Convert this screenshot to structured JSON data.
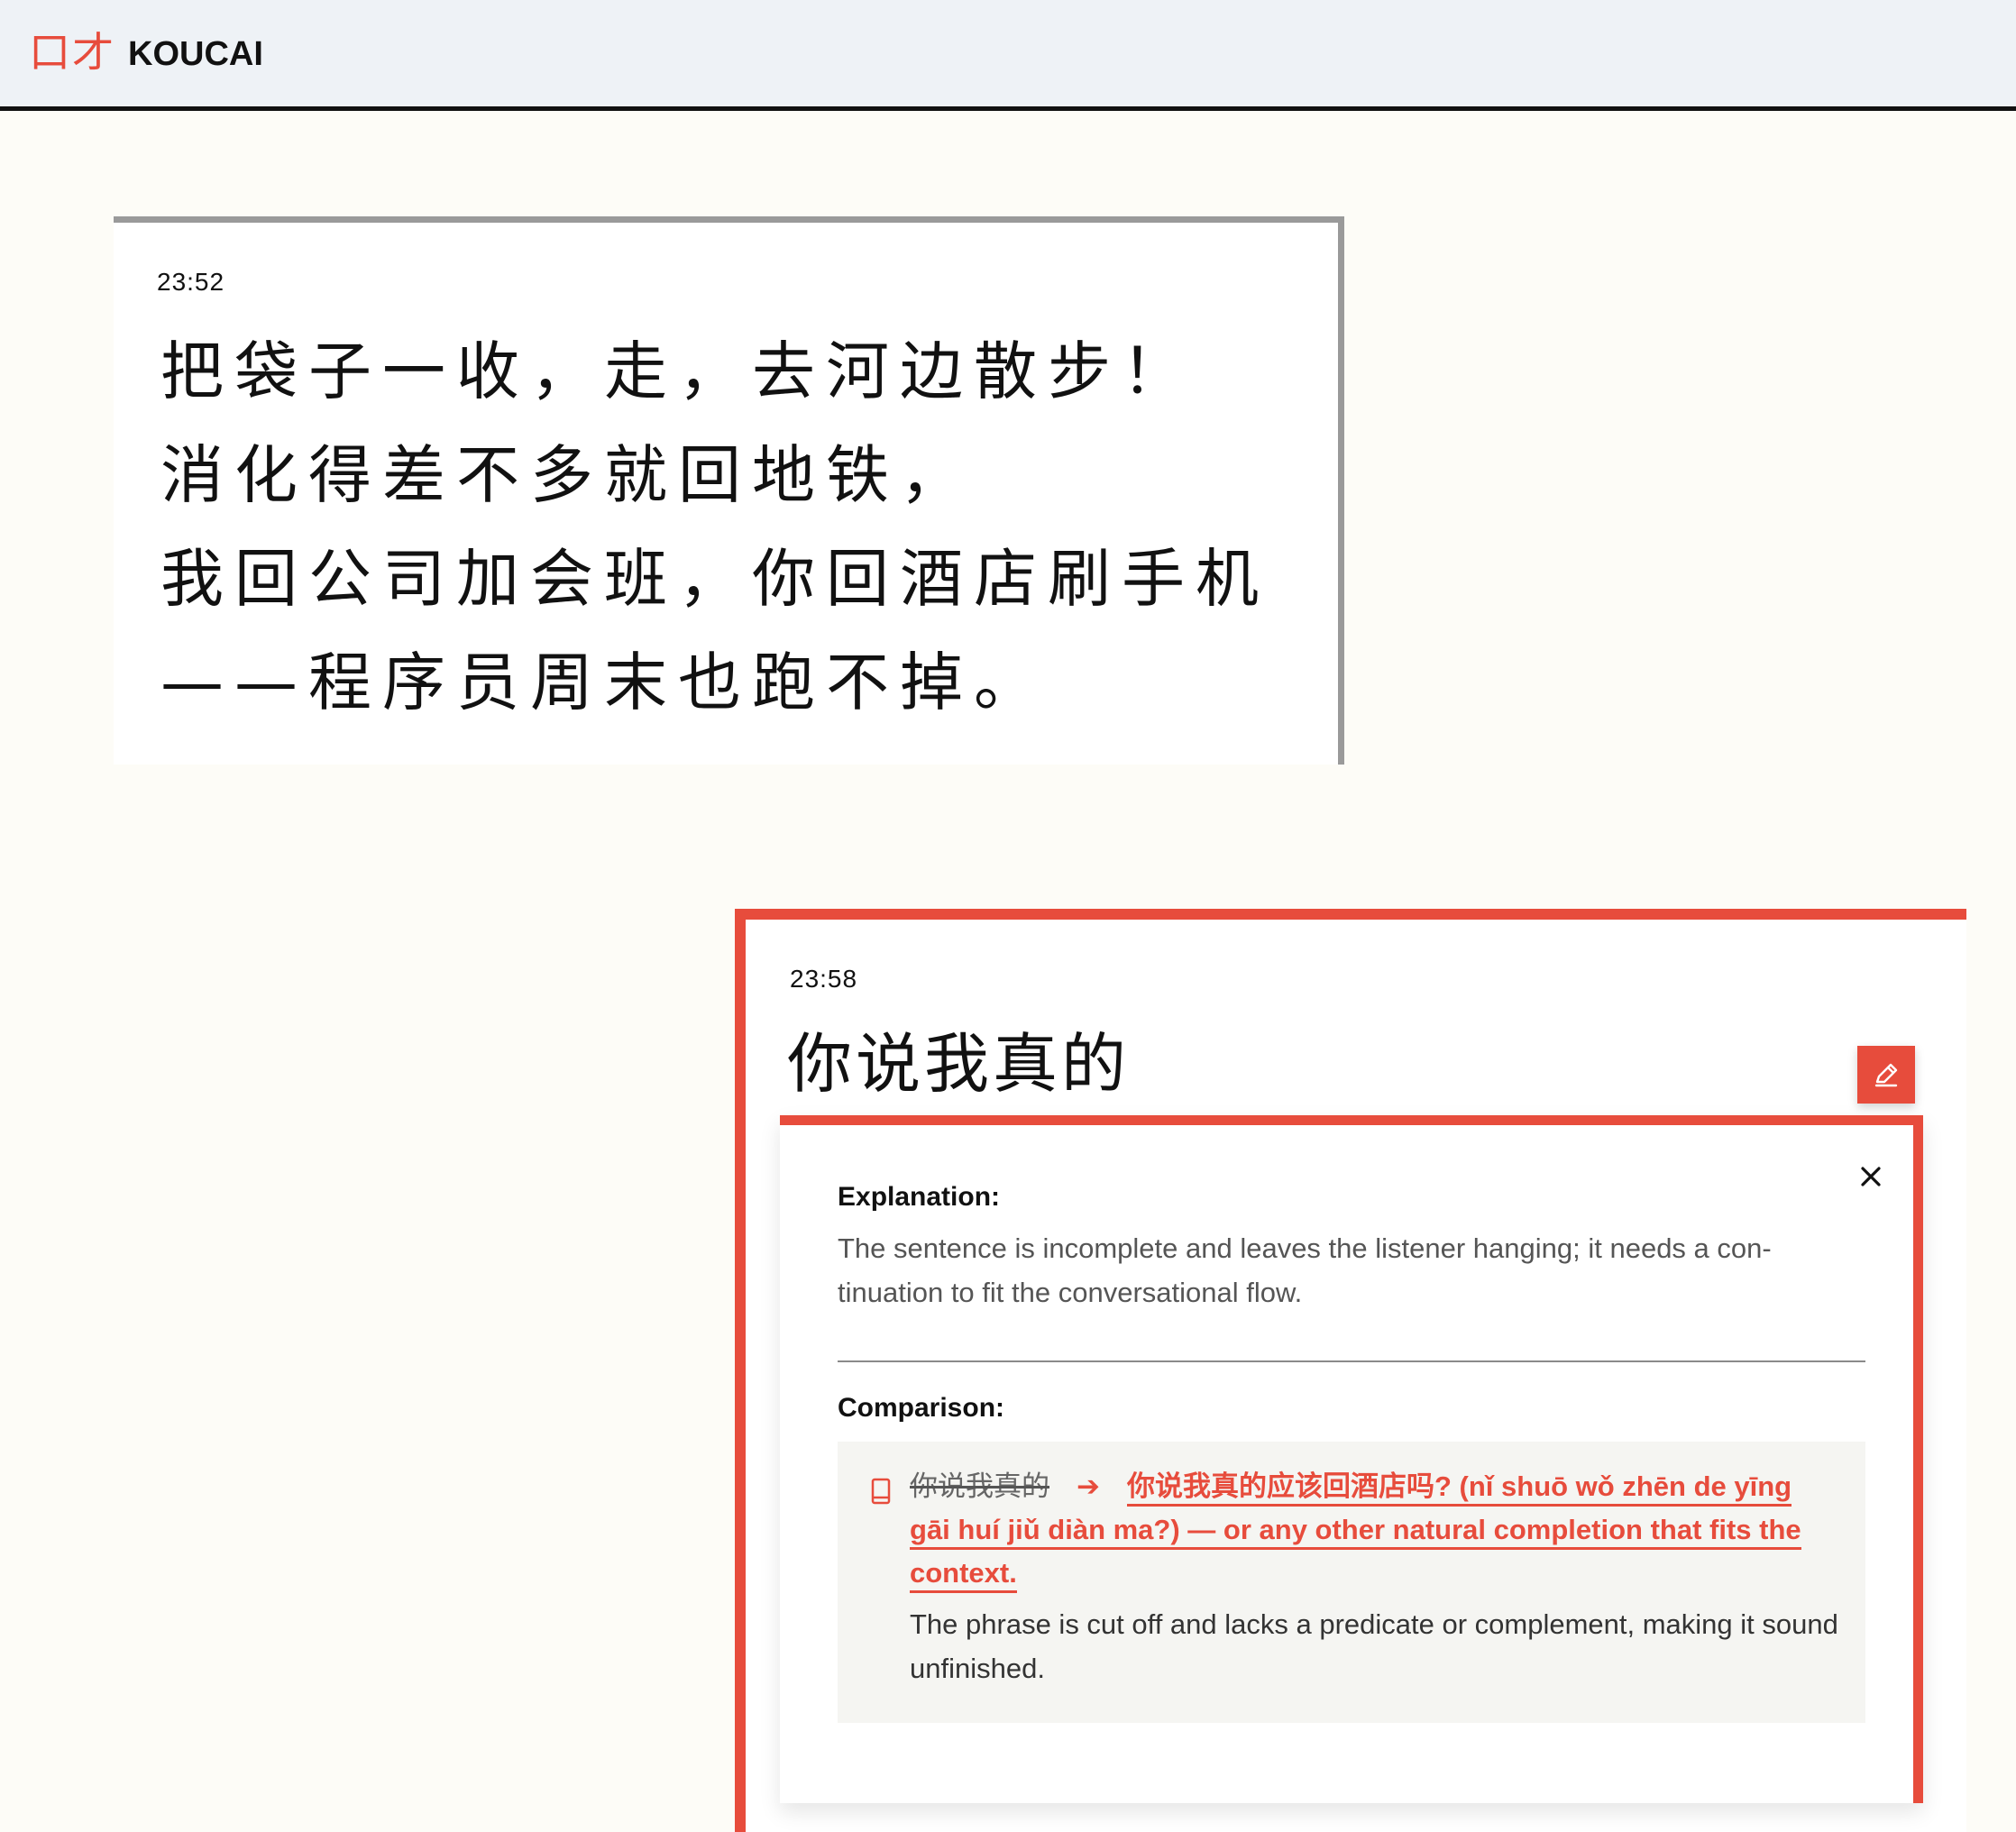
{
  "header": {
    "logo_cn": "口才",
    "logo_en": "KOUCAI",
    "accent_color": "#e74c3c"
  },
  "messages": [
    {
      "time": "23:52",
      "lines": [
        "把袋子一收，走，去河边散步！",
        "消化得差不多就回地铁，",
        "我回公司加会班，你回酒店刷手机",
        "——程序员周末也跑不掉。"
      ]
    },
    {
      "time": "23:58",
      "text": "你说我真的",
      "edit_icon": "pencil-icon"
    }
  ],
  "feedback": {
    "close_icon": "close-icon",
    "explanation_title": "Explanation:",
    "explanation_text": "The sentence is incomplete and leaves the listener hanging; it needs a con-tinuation to fit the conversational flow.",
    "comparison_title": "Comparison:",
    "comparison": {
      "icon": "book-icon",
      "original": "你说我真的",
      "arrow": "➔",
      "correction": "你说我真的应该回酒店吗? (nǐ shuō wǒ zhēn de yīng gāi huí jiǔ diàn ma?) — or any other natural completion that fits the context.",
      "note": "The phrase is cut off and lacks a predicate or complement, making it sound unfinished."
    }
  }
}
